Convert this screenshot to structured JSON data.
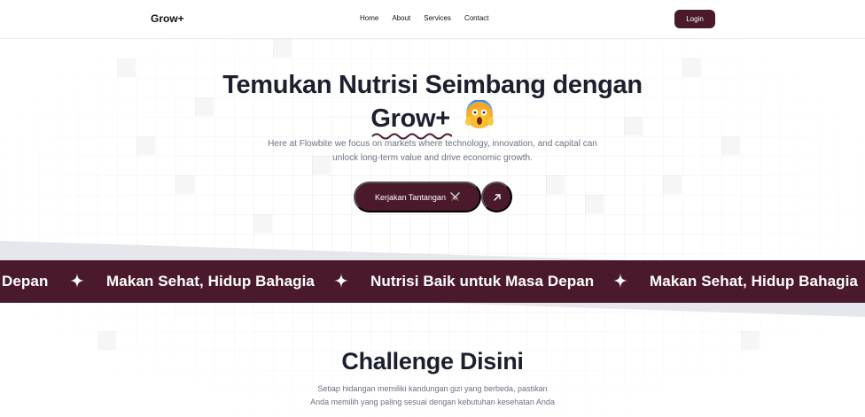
{
  "header": {
    "brand": "Grow+",
    "nav": [
      "Home",
      "About",
      "Services",
      "Contact"
    ],
    "login_label": "Login"
  },
  "hero": {
    "title_line1": "Temukan Nutrisi Seimbang dengan",
    "title_brand": "Grow+",
    "emoji": "face-screaming-in-fear-icon",
    "subtitle_line1": "Here at Flowbite we focus on markets where technology, innovation, and capital can",
    "subtitle_line2": "unlock long-term value and drive economic growth.",
    "cta_label": "Kerjakan Tantangan",
    "cta_icon": "crossed-swords-icon",
    "arrow_icon": "arrow-up-right-icon"
  },
  "marquee": {
    "items": [
      "Depan",
      "Makan Sehat, Hidup Bahagia",
      "Nutrisi Baik untuk Masa Depan",
      "Makan Sehat, Hidup Bahagia"
    ],
    "separator_icon": "sparkle-star-icon"
  },
  "challenge": {
    "title": "Challenge Disini",
    "subtitle_line1": "Setiap hidangan memiliki kandungan gizi yang berbeda, pastikan",
    "subtitle_line2": "Anda memilih yang paling sesuai dengan kebutuhan kesehatan Anda"
  },
  "colors": {
    "brand_primary": "#4a1a2c",
    "heading": "#1c1f2e",
    "body_text": "#6b7280",
    "squiggle": "#4a1a2c"
  }
}
